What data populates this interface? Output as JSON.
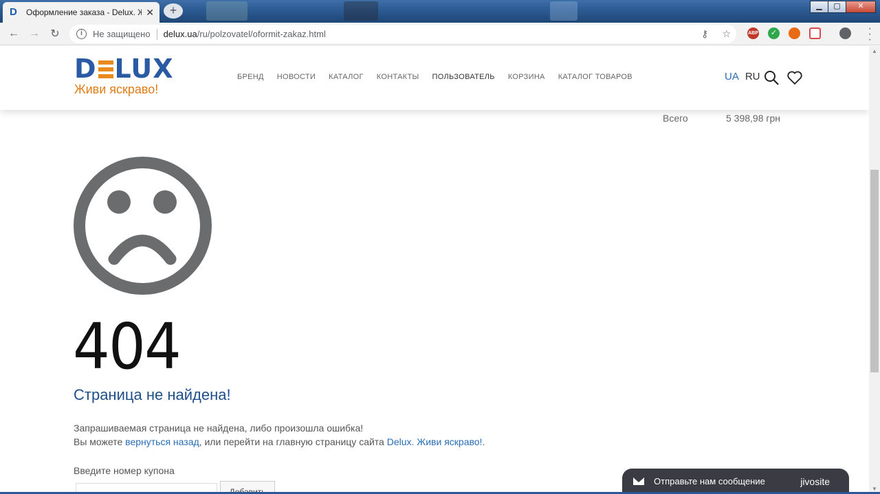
{
  "browser": {
    "tab_title": "Оформление заказа - Delux. Живи яскраво!",
    "tab_favicon": "D",
    "new_tab": "+",
    "url_security": "Не защищено",
    "url_host": "delux.ua",
    "url_path": "/ru/polzovatel/oformit-zakaz.html",
    "extensions": [
      {
        "name": "adblock-icon",
        "label": "ABP",
        "color": "#c0392b"
      },
      {
        "name": "check-icon",
        "label": "✓",
        "color": "#2ea84a"
      },
      {
        "name": "fire-icon",
        "label": "",
        "color": "#e86a12"
      },
      {
        "name": "pocket-icon",
        "label": "",
        "color": "#d94a4a"
      }
    ]
  },
  "site": {
    "logo": {
      "brand": "DELUX",
      "slogan": "Живи яскраво!"
    },
    "nav": [
      {
        "label": "БРЕНД"
      },
      {
        "label": "НОВОСТИ"
      },
      {
        "label": "КАТАЛОГ"
      },
      {
        "label": "КОНТАКТЫ"
      },
      {
        "label": "ПОЛЬЗОВАТЕЛЬ"
      },
      {
        "label": "КОРЗИНА"
      },
      {
        "label": "КАТАЛОГ ТОВАРОВ"
      }
    ],
    "lang": {
      "ua": "UA",
      "ru": "RU"
    },
    "accent": "#2a6db5"
  },
  "cart": {
    "total_label": "Всего",
    "total_value": "5 398,98 грн"
  },
  "error": {
    "code": "404",
    "title": "Страница не найдена!",
    "line1": "Запрашиваемая страница не найдена, либо произошла ошибка!",
    "line2_pre": "Вы можете ",
    "back_link": "вернуться назад",
    "line2_mid": ", или перейти на главную страницу сайта ",
    "home_link": "Delux. Живи яскраво!",
    "line2_post": "."
  },
  "coupon": {
    "label": "Введите номер купона",
    "button": "Добавить"
  },
  "chat": {
    "text": "Отправьте нам сообщение",
    "brand": "jivosite"
  }
}
